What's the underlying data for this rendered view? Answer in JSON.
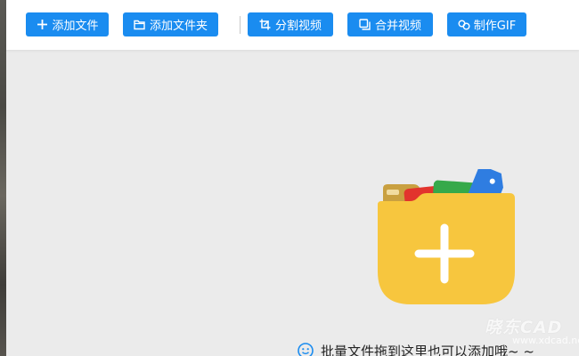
{
  "toolbar": {
    "buttons": [
      {
        "label": "添加文件",
        "icon": "plus-icon"
      },
      {
        "label": "添加文件夹",
        "icon": "folder-icon"
      },
      {
        "label": "分割视频",
        "icon": "crop-icon"
      },
      {
        "label": "合并视频",
        "icon": "copy-icon"
      },
      {
        "label": "制作GIF",
        "icon": "link-icon"
      }
    ]
  },
  "dropzone": {
    "illustration": "folder-add-icon",
    "hint": "批量文件拖到这里也可以添加哦~ ~"
  },
  "watermark": {
    "text": "晓东CAD",
    "subtext": "www.xdcad.net"
  },
  "colors": {
    "accent": "#1a8cf0",
    "background": "#ebebeb",
    "folder": "#f7c63e"
  }
}
